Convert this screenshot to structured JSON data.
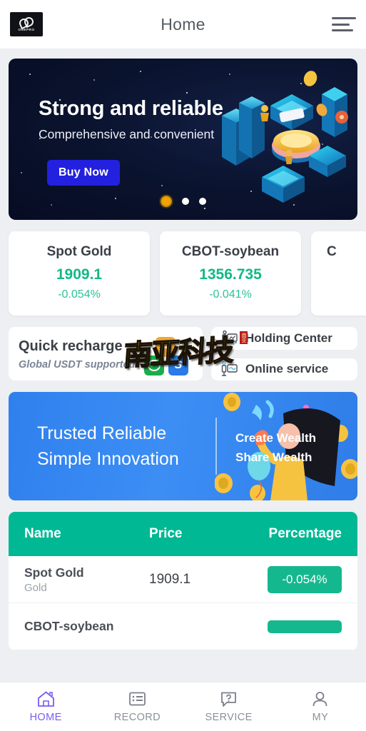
{
  "header": {
    "title": "Home",
    "logo_text": "ONEPRO",
    "logo_icon": "chain-link-icon",
    "menu_icon": "hamburger-menu-icon"
  },
  "banner": {
    "headline": "Strong and reliable",
    "subheadline": "Comprehensive and convenient",
    "cta_label": "Buy Now",
    "cta_color": "#2320e0",
    "dots_total": 3,
    "dot_active_index": 0,
    "active_dot_color": "#f0a500"
  },
  "price_cards": [
    {
      "name": "Spot Gold",
      "price": "1909.1",
      "change": "-0.054%"
    },
    {
      "name": "CBOT-soybean",
      "price": "1356.735",
      "change": "-0.041%"
    },
    {
      "name": "C",
      "price": "",
      "change": ""
    }
  ],
  "quick_recharge": {
    "title": "Quick recharge",
    "subtitle": "Global USDT supportcd",
    "pay_icons": [
      "usdt-icon",
      "wechat-pay-icon",
      "skype-pay-icon"
    ]
  },
  "action_buttons": [
    {
      "label": "Holding Center",
      "icon": "holding-chart-icon"
    },
    {
      "label": "Online service",
      "icon": "online-service-icon"
    }
  ],
  "watermark": {
    "text": "南亚科技",
    "seal_text": "南亚"
  },
  "promo": {
    "line1": "Trusted Reliable",
    "line2": "Simple Innovation",
    "right_line1": "Create Wealth",
    "right_line2": "Share  Wealth",
    "bg_color": "#2f80ed"
  },
  "table": {
    "header_color": "#00b894",
    "columns": [
      "Name",
      "Price",
      "Percentage"
    ],
    "rows": [
      {
        "name": "Spot Gold",
        "sub": "Gold",
        "price": "1909.1",
        "percentage": "-0.054%"
      },
      {
        "name": "CBOT-soybean",
        "sub": "",
        "price": "",
        "percentage": ""
      }
    ]
  },
  "bottom_nav": {
    "active_color": "#7b5cf0",
    "items": [
      {
        "label": "HOME",
        "icon": "home-icon"
      },
      {
        "label": "RECORD",
        "icon": "list-icon"
      },
      {
        "label": "SERVICE",
        "icon": "question-bubble-icon"
      },
      {
        "label": "MY",
        "icon": "person-icon"
      }
    ]
  }
}
